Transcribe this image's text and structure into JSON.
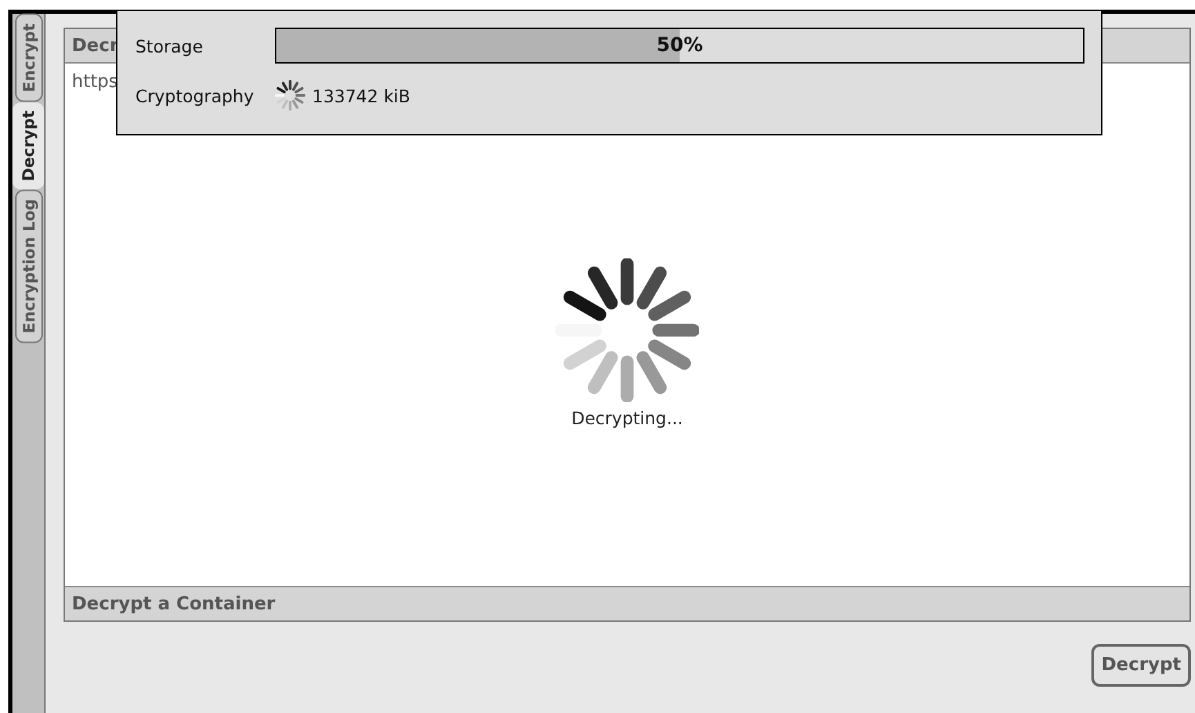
{
  "tabs": [
    {
      "label": "Encrypt",
      "selected": false
    },
    {
      "label": "Decrypt",
      "selected": true
    },
    {
      "label": "Encryption Log",
      "selected": false
    }
  ],
  "panel": {
    "title": "Decr",
    "content": "https",
    "status": "Decrypting...",
    "footer": "Decrypt a Container"
  },
  "overlay": {
    "rows": [
      {
        "kind": "progress",
        "label": "Storage",
        "level": 0.5,
        "reading": "50%"
      },
      {
        "kind": "spinner",
        "label": "Cryptography",
        "reading": "133742 kiB"
      }
    ]
  },
  "buttons": [
    {
      "label": "Decrypt"
    }
  ]
}
